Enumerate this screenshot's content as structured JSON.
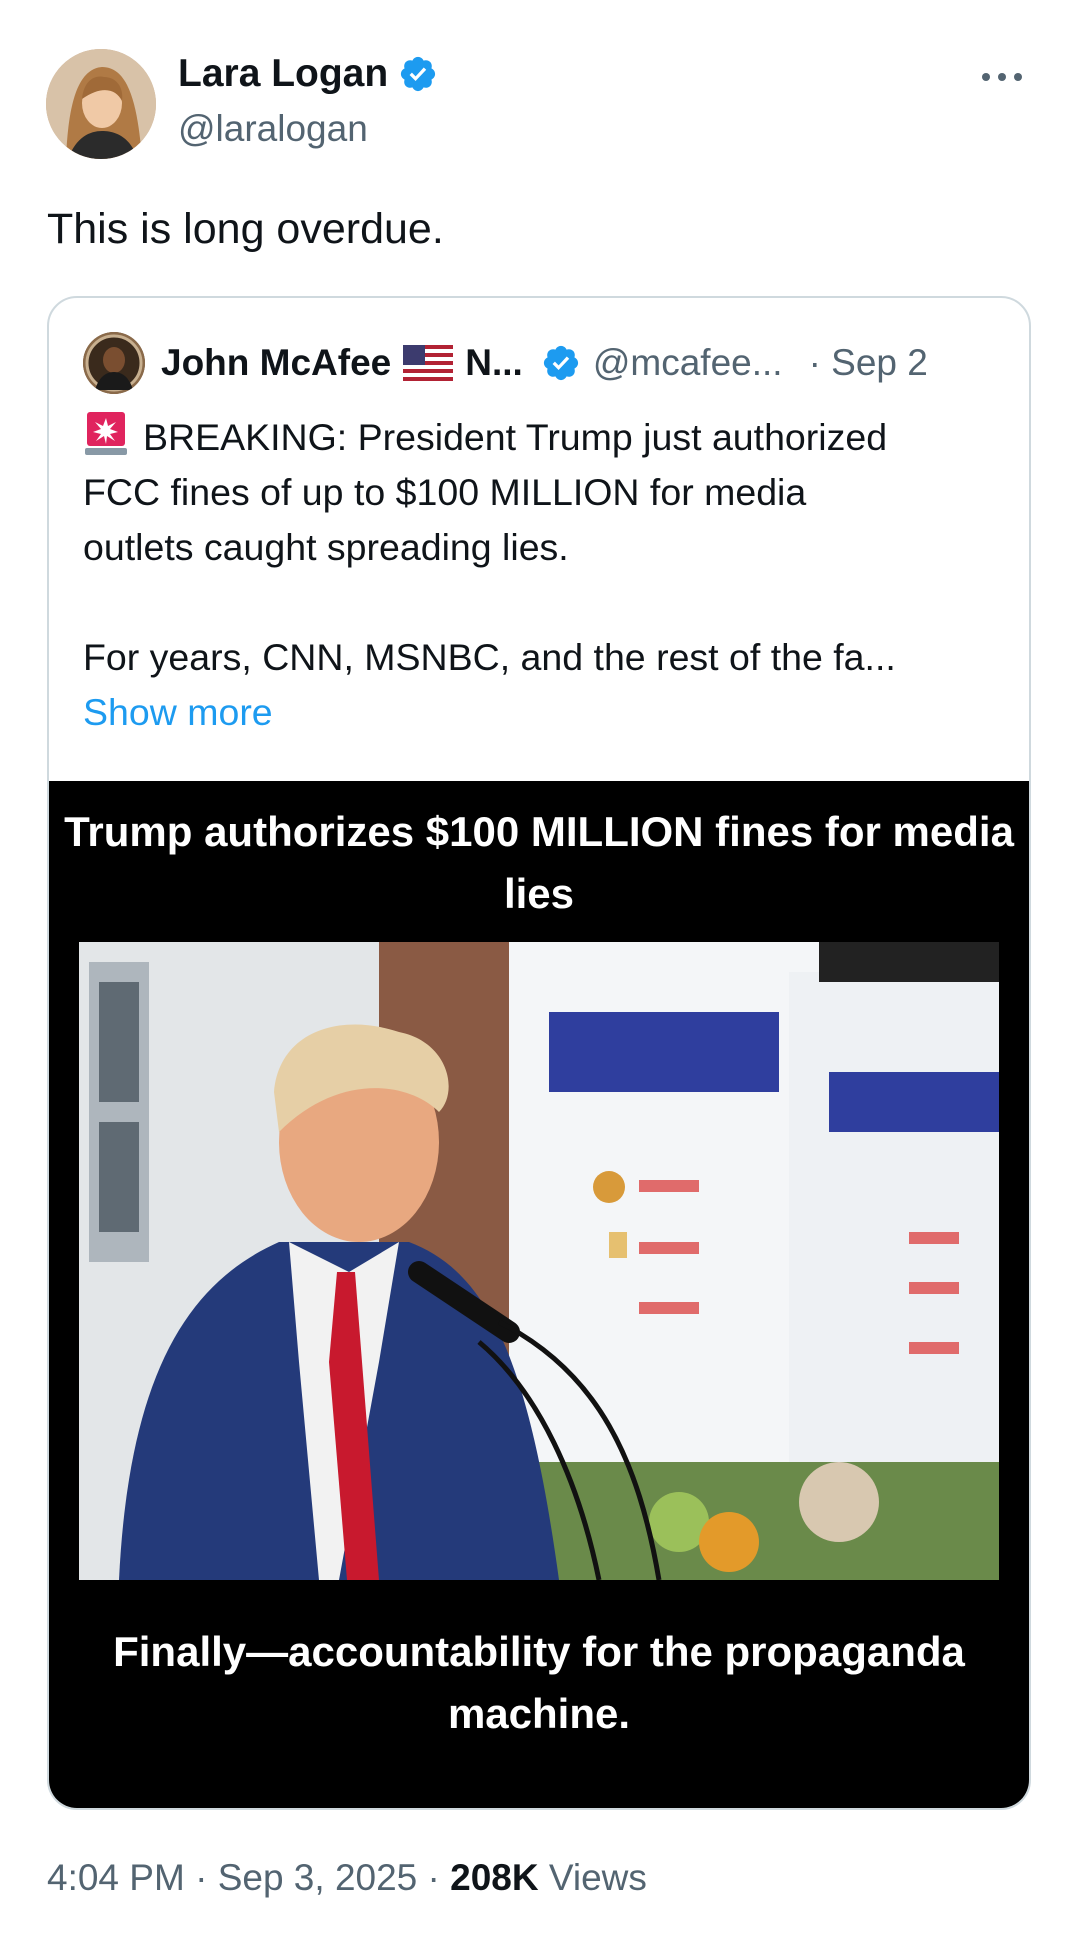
{
  "tweet": {
    "author_name": "Lara Logan",
    "author_handle": "@laralogan",
    "text": "This is long overdue.",
    "time": "4:04 PM",
    "date": "Sep 3, 2025",
    "views_count": "208K",
    "views_label": "Views",
    "separator": "·"
  },
  "quoted": {
    "author_name": "John McAfee",
    "author_name_suffix": "N...",
    "author_handle": "@mcafee...",
    "date": "· Sep 2",
    "line1": "BREAKING: President Trump just authorized",
    "line2": "FCC fines of up to $100 MILLION for media",
    "line3": "outlets caught spreading lies.",
    "line4": "For years, CNN, MSNBC, and the rest of the fa...",
    "show_more": "Show more",
    "media_title": "Trump authorizes $100 MILLION fines for media lies",
    "media_caption": "Finally—accountability for the propaganda machine."
  },
  "colors": {
    "accent_blue": "#1d9bf0",
    "text_primary": "#0f1419",
    "text_secondary": "#536471",
    "card_border": "#cfd9de"
  },
  "icons": {
    "verified": "verified-badge-icon",
    "more": "more-horizontal-icon",
    "siren": "rotating-light-emoji",
    "flag": "us-flag-emoji"
  }
}
